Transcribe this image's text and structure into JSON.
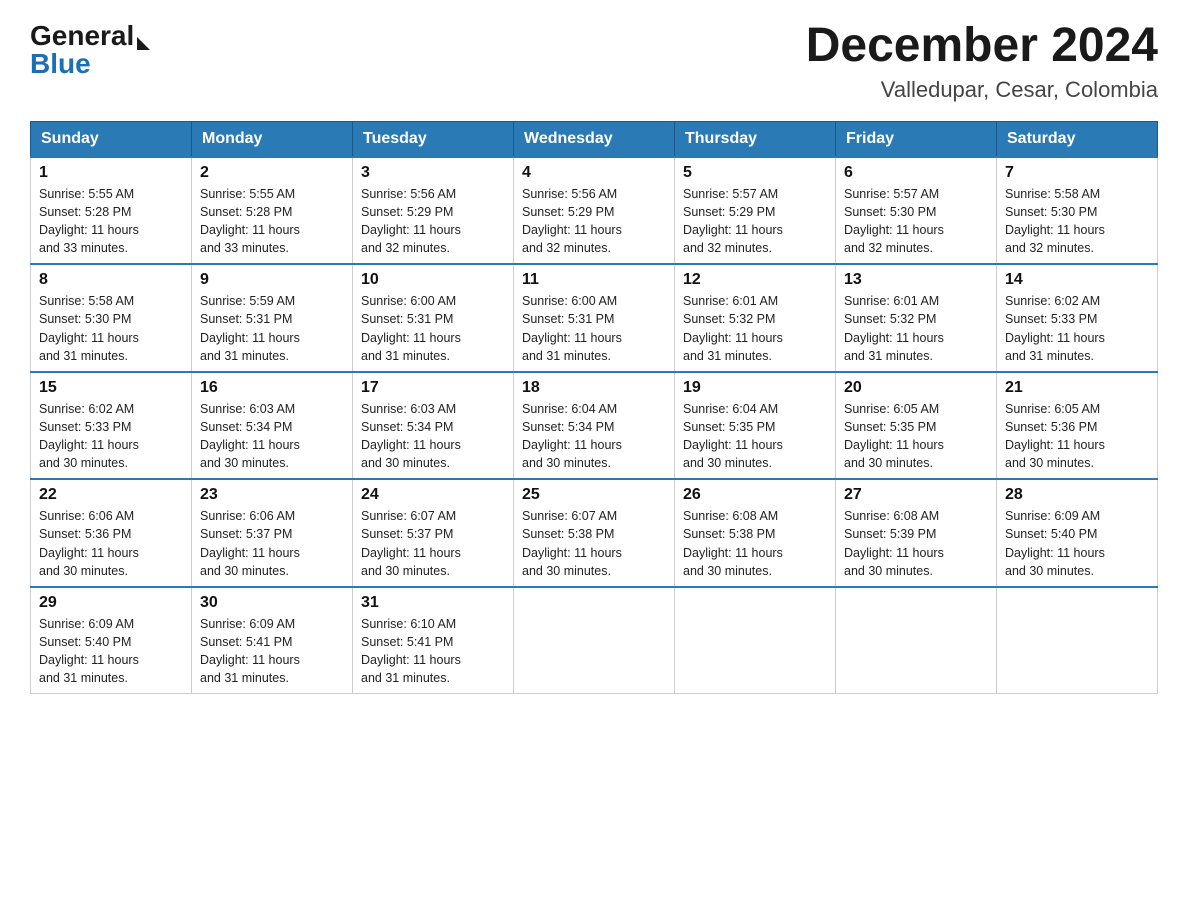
{
  "header": {
    "logo_general": "General",
    "logo_blue": "Blue",
    "month_title": "December 2024",
    "location": "Valledupar, Cesar, Colombia"
  },
  "days_of_week": [
    "Sunday",
    "Monday",
    "Tuesday",
    "Wednesday",
    "Thursday",
    "Friday",
    "Saturday"
  ],
  "weeks": [
    [
      {
        "day": "1",
        "sunrise": "5:55 AM",
        "sunset": "5:28 PM",
        "daylight": "11 hours and 33 minutes."
      },
      {
        "day": "2",
        "sunrise": "5:55 AM",
        "sunset": "5:28 PM",
        "daylight": "11 hours and 33 minutes."
      },
      {
        "day": "3",
        "sunrise": "5:56 AM",
        "sunset": "5:29 PM",
        "daylight": "11 hours and 32 minutes."
      },
      {
        "day": "4",
        "sunrise": "5:56 AM",
        "sunset": "5:29 PM",
        "daylight": "11 hours and 32 minutes."
      },
      {
        "day": "5",
        "sunrise": "5:57 AM",
        "sunset": "5:29 PM",
        "daylight": "11 hours and 32 minutes."
      },
      {
        "day": "6",
        "sunrise": "5:57 AM",
        "sunset": "5:30 PM",
        "daylight": "11 hours and 32 minutes."
      },
      {
        "day": "7",
        "sunrise": "5:58 AM",
        "sunset": "5:30 PM",
        "daylight": "11 hours and 32 minutes."
      }
    ],
    [
      {
        "day": "8",
        "sunrise": "5:58 AM",
        "sunset": "5:30 PM",
        "daylight": "11 hours and 31 minutes."
      },
      {
        "day": "9",
        "sunrise": "5:59 AM",
        "sunset": "5:31 PM",
        "daylight": "11 hours and 31 minutes."
      },
      {
        "day": "10",
        "sunrise": "6:00 AM",
        "sunset": "5:31 PM",
        "daylight": "11 hours and 31 minutes."
      },
      {
        "day": "11",
        "sunrise": "6:00 AM",
        "sunset": "5:31 PM",
        "daylight": "11 hours and 31 minutes."
      },
      {
        "day": "12",
        "sunrise": "6:01 AM",
        "sunset": "5:32 PM",
        "daylight": "11 hours and 31 minutes."
      },
      {
        "day": "13",
        "sunrise": "6:01 AM",
        "sunset": "5:32 PM",
        "daylight": "11 hours and 31 minutes."
      },
      {
        "day": "14",
        "sunrise": "6:02 AM",
        "sunset": "5:33 PM",
        "daylight": "11 hours and 31 minutes."
      }
    ],
    [
      {
        "day": "15",
        "sunrise": "6:02 AM",
        "sunset": "5:33 PM",
        "daylight": "11 hours and 30 minutes."
      },
      {
        "day": "16",
        "sunrise": "6:03 AM",
        "sunset": "5:34 PM",
        "daylight": "11 hours and 30 minutes."
      },
      {
        "day": "17",
        "sunrise": "6:03 AM",
        "sunset": "5:34 PM",
        "daylight": "11 hours and 30 minutes."
      },
      {
        "day": "18",
        "sunrise": "6:04 AM",
        "sunset": "5:34 PM",
        "daylight": "11 hours and 30 minutes."
      },
      {
        "day": "19",
        "sunrise": "6:04 AM",
        "sunset": "5:35 PM",
        "daylight": "11 hours and 30 minutes."
      },
      {
        "day": "20",
        "sunrise": "6:05 AM",
        "sunset": "5:35 PM",
        "daylight": "11 hours and 30 minutes."
      },
      {
        "day": "21",
        "sunrise": "6:05 AM",
        "sunset": "5:36 PM",
        "daylight": "11 hours and 30 minutes."
      }
    ],
    [
      {
        "day": "22",
        "sunrise": "6:06 AM",
        "sunset": "5:36 PM",
        "daylight": "11 hours and 30 minutes."
      },
      {
        "day": "23",
        "sunrise": "6:06 AM",
        "sunset": "5:37 PM",
        "daylight": "11 hours and 30 minutes."
      },
      {
        "day": "24",
        "sunrise": "6:07 AM",
        "sunset": "5:37 PM",
        "daylight": "11 hours and 30 minutes."
      },
      {
        "day": "25",
        "sunrise": "6:07 AM",
        "sunset": "5:38 PM",
        "daylight": "11 hours and 30 minutes."
      },
      {
        "day": "26",
        "sunrise": "6:08 AM",
        "sunset": "5:38 PM",
        "daylight": "11 hours and 30 minutes."
      },
      {
        "day": "27",
        "sunrise": "6:08 AM",
        "sunset": "5:39 PM",
        "daylight": "11 hours and 30 minutes."
      },
      {
        "day": "28",
        "sunrise": "6:09 AM",
        "sunset": "5:40 PM",
        "daylight": "11 hours and 30 minutes."
      }
    ],
    [
      {
        "day": "29",
        "sunrise": "6:09 AM",
        "sunset": "5:40 PM",
        "daylight": "11 hours and 31 minutes."
      },
      {
        "day": "30",
        "sunrise": "6:09 AM",
        "sunset": "5:41 PM",
        "daylight": "11 hours and 31 minutes."
      },
      {
        "day": "31",
        "sunrise": "6:10 AM",
        "sunset": "5:41 PM",
        "daylight": "11 hours and 31 minutes."
      },
      null,
      null,
      null,
      null
    ]
  ],
  "labels": {
    "sunrise": "Sunrise:",
    "sunset": "Sunset:",
    "daylight": "Daylight:"
  }
}
